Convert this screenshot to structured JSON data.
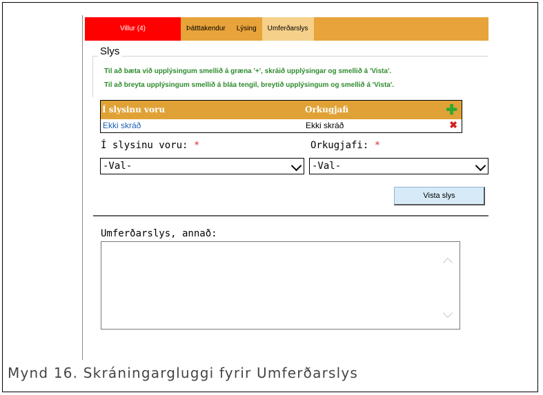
{
  "tabs": [
    {
      "label": "Villur (4)",
      "type": "errors"
    },
    {
      "label": "Þátttakendur",
      "type": "normal"
    },
    {
      "label": "Lýsing",
      "type": "normal"
    },
    {
      "label": "Umferðarslys",
      "type": "active"
    }
  ],
  "section": {
    "legend": "Slys",
    "hint_add": "Til að bæta við upplýsingum smellið á græna '+', skráið upplýsingar og smellið á 'Vista'.",
    "hint_edit": "Til að breyta upplýsingum smellið á bláa tengil, breytið upplýsingum og smellið á 'Vista'."
  },
  "grid": {
    "columns": [
      "Í slysinu voru",
      "Orkugjafi"
    ],
    "add_icon": "plus-icon",
    "rows": [
      {
        "link": "Ekki skráð",
        "value": "Ekki skráð",
        "delete_icon": "delete-x-icon"
      }
    ]
  },
  "form": {
    "field1_label": "Í slysinu voru:",
    "field2_label": "Orkugjafi:",
    "required_mark": "*",
    "select1_value": "-Val-",
    "select2_value": "-Val-",
    "save_button": "Vista slys",
    "other_label": "Umferðarslys, annað:"
  },
  "caption": "Mynd 16. Skráningargluggi fyrir Umferðarslys",
  "colors": {
    "tab_bar": "#e8a33a",
    "error_tab": "#ff0000",
    "active_tab": "#f5d08a",
    "grid_header": "#e0a236",
    "hint_text": "#2e8b2e",
    "link": "#1a5fb4",
    "button_bg": "#d6ebf7"
  }
}
